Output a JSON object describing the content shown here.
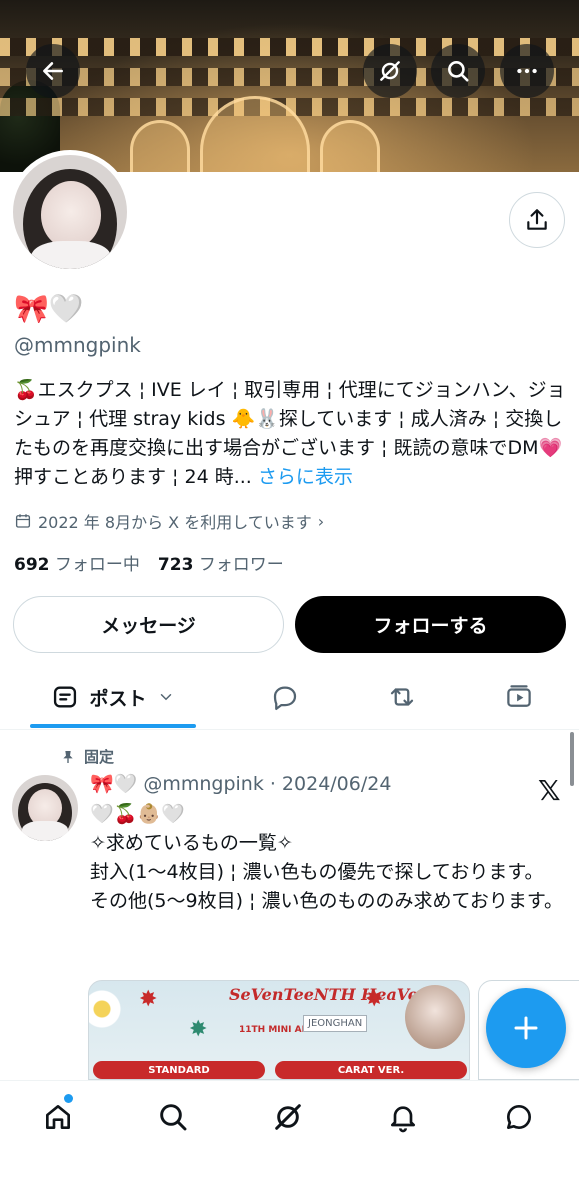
{
  "profile": {
    "display_name": "🎀🤍",
    "handle": "@mmngpink",
    "bio": "🍒エスクプス ¦ IVE レイ ¦ 取引専用 ¦ 代理にてジョンハン、ジョシュア ¦ 代理 stray kids 🐥🐰探しています ¦ 成人済み ¦ 交換したものを再度交換に出す場合がございます ¦ 既読の意味でDM💗押すことあります ¦ 24 時... ",
    "bio_more": "さらに表示",
    "joined": "2022 年 8月から X を利用しています",
    "following_count": "692",
    "following_label": "フォロー中",
    "followers_count": "723",
    "followers_label": "フォロワー",
    "message_label": "メッセージ",
    "follow_label": "フォローする"
  },
  "tabs": {
    "posts_label": "ポスト"
  },
  "post": {
    "pinned_label": "固定",
    "author_name": "🎀🤍",
    "author_handle": "@mmngpink",
    "date": "· 2024/06/24",
    "body": "🤍🍒👶🏼🤍\n✧求めているもの一覧✧\n封入(1〜4枚目) ¦ 濃い色もの優先で探しております。\nその他(5〜9枚目) ¦ 濃い色のもののみ求めております。",
    "card": {
      "album_title": "SeVenTeeNTH HeaVen",
      "album_sub": "11TH MINI ALBUM",
      "member": "JEONGHAN",
      "pill_left": "STANDARD",
      "pill_right": "CARAT VER."
    }
  },
  "colors": {
    "accent": "#1d9bf0",
    "text": "#0f1419",
    "muted": "#536471",
    "border": "#cfd9de"
  },
  "icons": {
    "back": "back-arrow-icon",
    "grok": "grok-icon",
    "search": "search-icon",
    "more": "more-icon",
    "share": "share-icon",
    "calendar": "calendar-icon"
  }
}
